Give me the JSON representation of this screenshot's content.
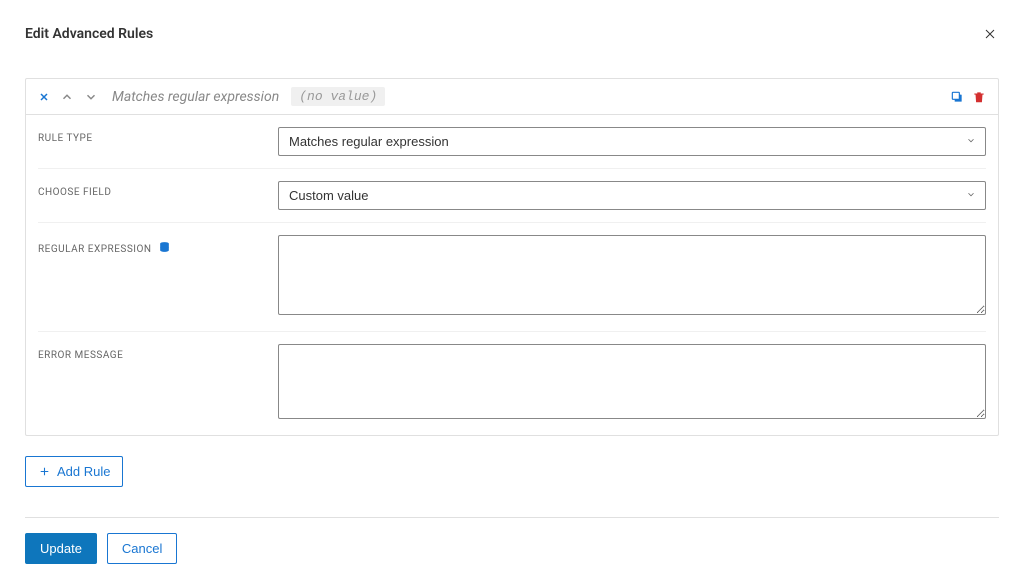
{
  "modal": {
    "title": "Edit Advanced Rules"
  },
  "rule": {
    "header_title": "Matches regular expression",
    "header_badge": "(no value)",
    "fields": {
      "ruleType": {
        "label": "Rule Type",
        "value": "Matches regular expression"
      },
      "chooseField": {
        "label": "Choose Field",
        "value": "Custom value"
      },
      "regex": {
        "label": "Regular Expression",
        "value": ""
      },
      "errorMessage": {
        "label": "Error Message",
        "value": ""
      }
    }
  },
  "buttons": {
    "addRule": "Add Rule",
    "update": "Update",
    "cancel": "Cancel"
  }
}
